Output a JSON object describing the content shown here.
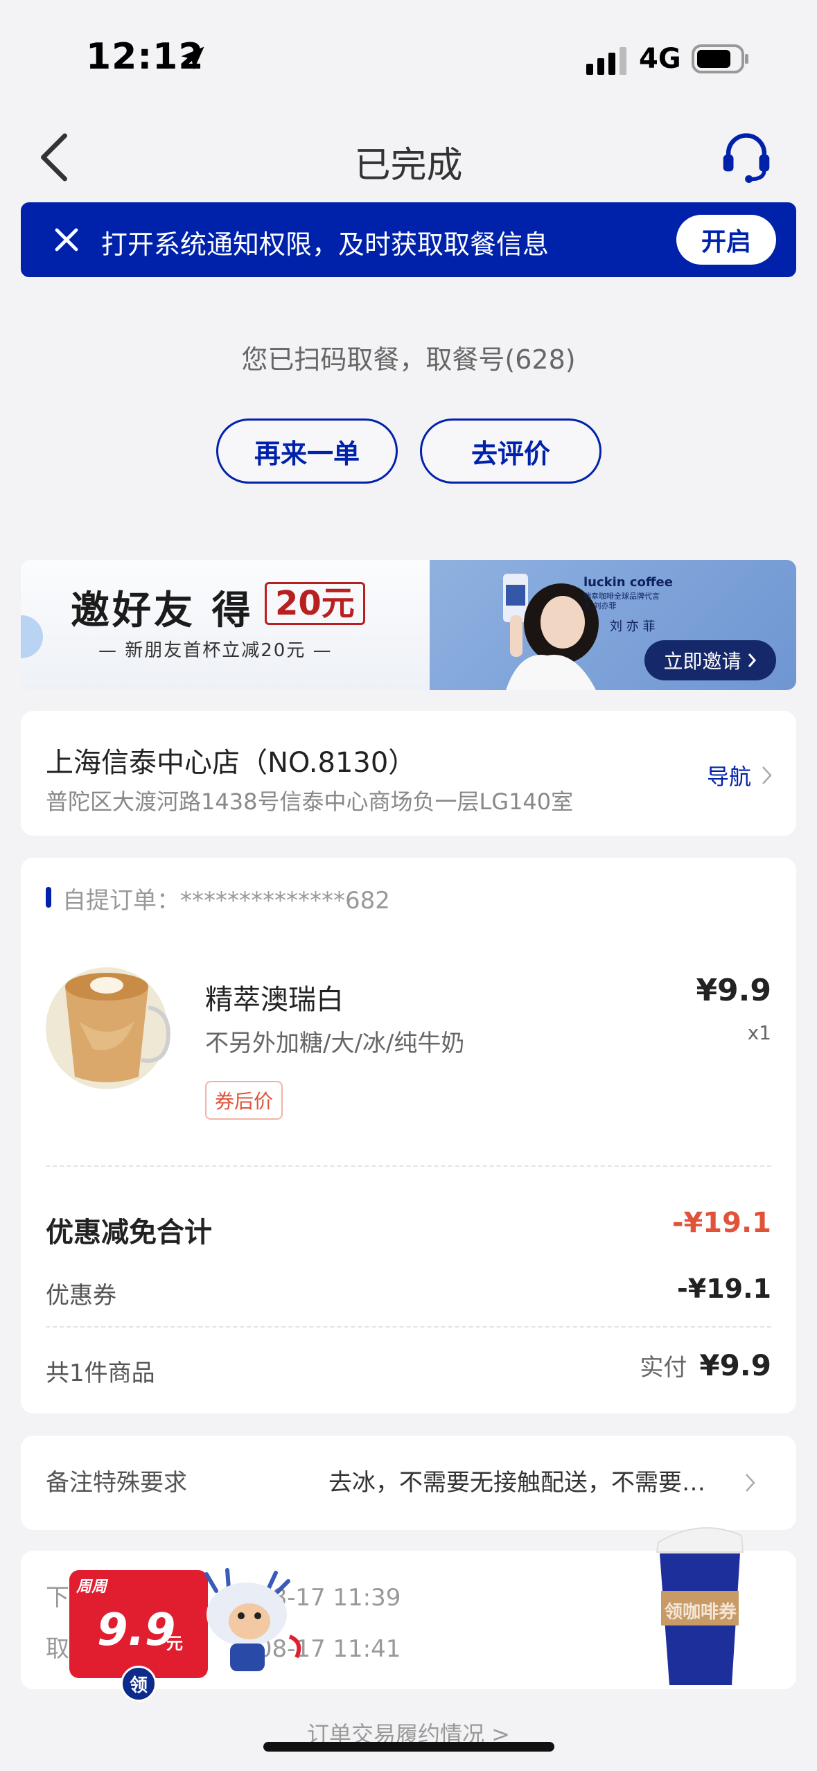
{
  "status": {
    "time": "12:12",
    "network": "4G"
  },
  "nav": {
    "title": "已完成",
    "back_icon": "chevron-left-icon",
    "service_icon": "headset-icon"
  },
  "notice": {
    "text": "打开系统通知权限，及时获取取餐信息",
    "button": "开启",
    "close_icon": "close-icon"
  },
  "pickup": {
    "message": "您已扫码取餐，取餐号(628)"
  },
  "actions": {
    "reorder": "再来一单",
    "review": "去评价"
  },
  "promo": {
    "title": "邀好友 得",
    "amount": "20元",
    "subtitle": "— 新朋友首杯立减20元 —",
    "brand": "luckin coffee",
    "brand_sub": "瑞幸咖啡全球品牌代言人 刘亦菲",
    "name": "刘 亦 菲",
    "button": "立即邀请"
  },
  "store": {
    "name": "上海信泰中心店（NO.8130）",
    "address": "普陀区大渡河路1438号信泰中心商场负一层LG140室",
    "nav_label": "导航"
  },
  "order": {
    "label": "自提订单：**************682",
    "product": {
      "name": "精萃澳瑞白",
      "options": "不另外加糖/大/冰/纯牛奶",
      "tag": "券后价",
      "price": "¥9.9",
      "qty": "x1"
    },
    "discount_total_label": "优惠减免合计",
    "discount_total_value": "-¥19.1",
    "coupon_label": "优惠券",
    "coupon_value": "-¥19.1",
    "count_label": "共1件商品",
    "paid_label": "实付",
    "paid_value": "¥9.9"
  },
  "remark": {
    "label": "备注特殊要求",
    "value": "去冰，不需要无接触配送，不需要…"
  },
  "times": {
    "row1_prefix": "下",
    "row1_value": "08-17 11:39",
    "row2_prefix": "取",
    "row2_value": "08-17 11:41"
  },
  "float_coupon": {
    "week": "周周",
    "price": "9.9",
    "unit": "元",
    "get": "领"
  },
  "cup_coupon": {
    "text": "领咖啡券"
  },
  "footer": {
    "link": "订单交易履约情况 >"
  },
  "colors": {
    "brand_blue": "#0022ab",
    "discount_red": "#e0533a"
  }
}
